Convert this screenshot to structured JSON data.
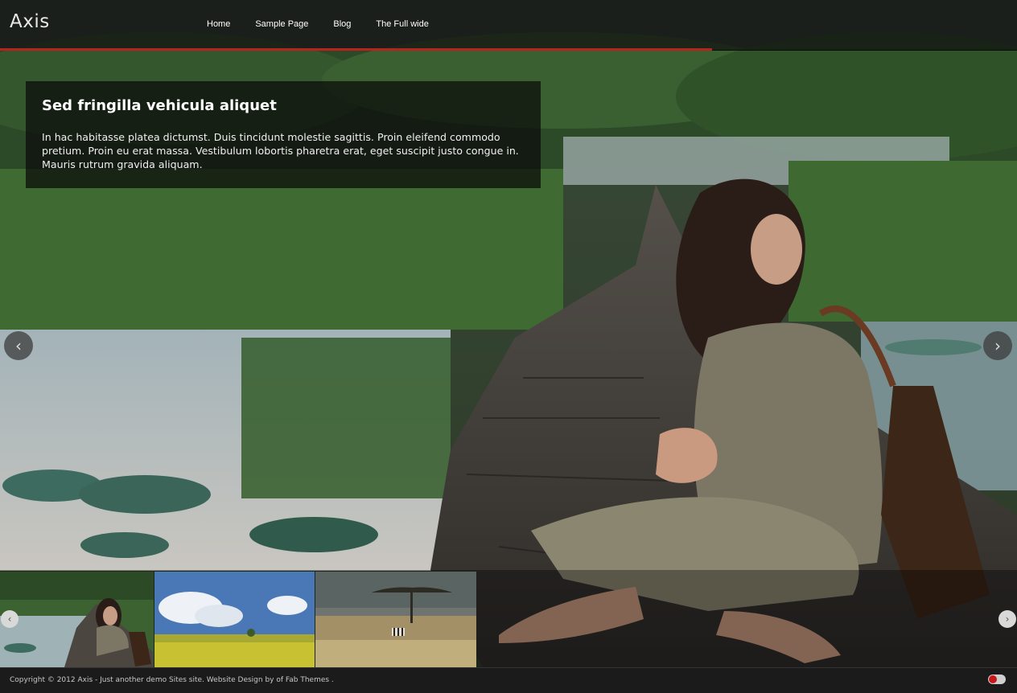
{
  "site": {
    "logo": "Axis"
  },
  "nav": {
    "items": [
      {
        "label": "Home"
      },
      {
        "label": "Sample Page"
      },
      {
        "label": "Blog"
      },
      {
        "label": "The Full wide"
      }
    ]
  },
  "slider": {
    "caption": {
      "title": "Sed fringilla vehicula aliquet",
      "text": "In hac habitasse platea dictumst. Duis tincidunt molestie sagittis. Proin eleifend commodo pretium. Proin eu erat massa. Vestibulum lobortis pharetra erat, eget suscipit justo congue in. Mauris rutrum gravida aliquam."
    },
    "prev_icon": "‹",
    "next_icon": "›",
    "progress": 0.7,
    "thumbnails": [
      {
        "name": "woman-in-boat"
      },
      {
        "name": "sky-and-field"
      },
      {
        "name": "savanna-zebra"
      }
    ],
    "thumb_prev_icon": "‹",
    "thumb_next_icon": "›"
  },
  "footer": {
    "text": "Copyright © 2012 Axis - Just another demo Sites site. Website Design by of Fab Themes ."
  },
  "colors": {
    "accent": "#b8231f",
    "header_bg": "#0f0f0f",
    "footer_bg": "#1b1b1b"
  }
}
